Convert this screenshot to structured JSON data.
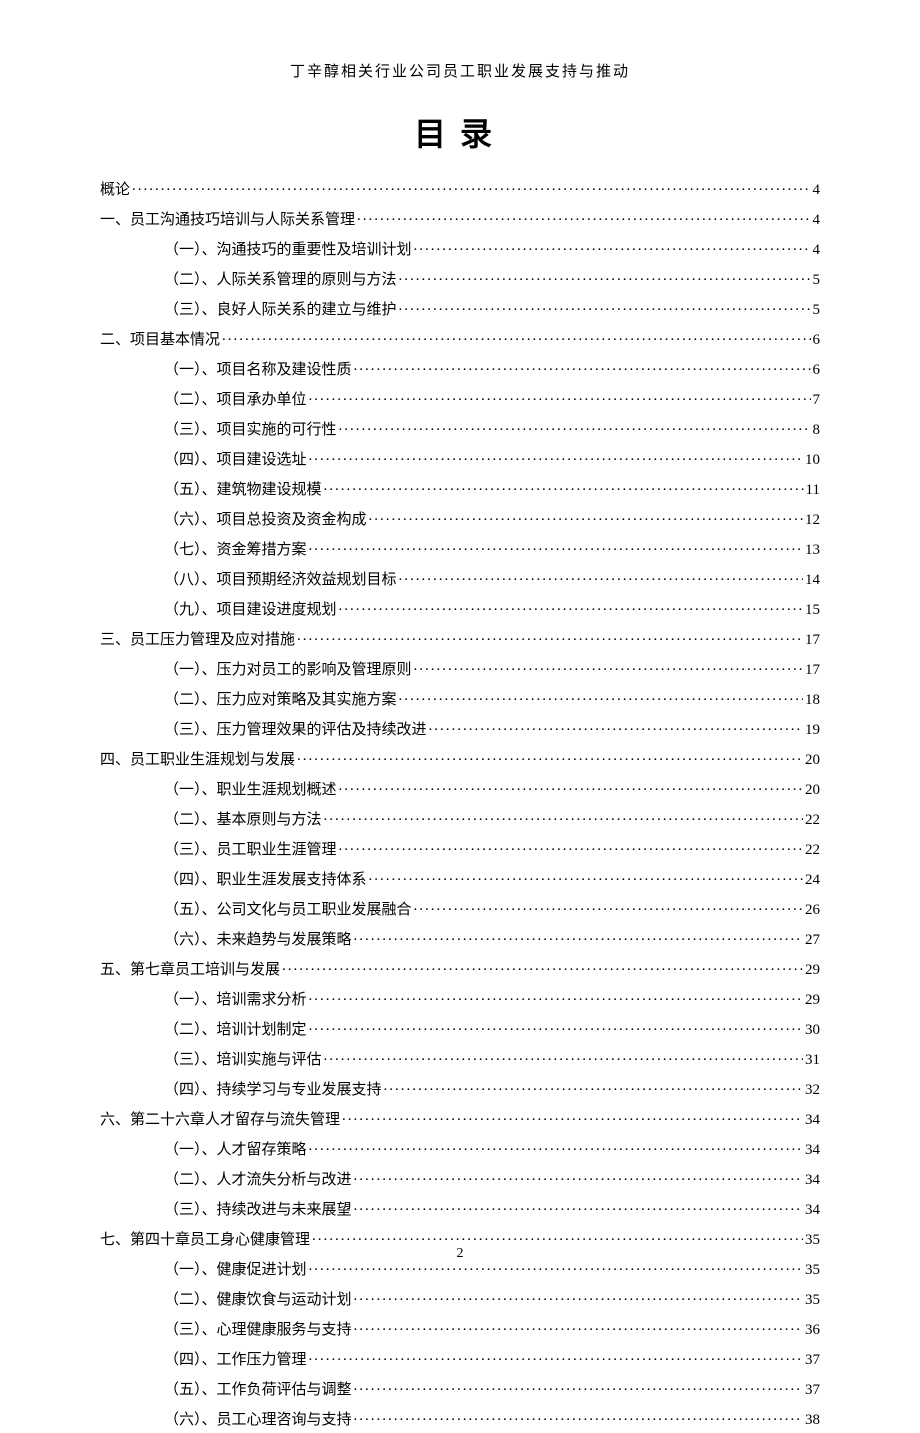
{
  "doc_header": "丁辛醇相关行业公司员工职业发展支持与推动",
  "toc_title": "目录",
  "page_number": "2",
  "toc": [
    {
      "level": 1,
      "label": "概论",
      "page": "4"
    },
    {
      "level": 1,
      "label": "一、员工沟通技巧培训与人际关系管理",
      "page": "4"
    },
    {
      "level": 2,
      "label": "（一）、沟通技巧的重要性及培训计划",
      "page": "4"
    },
    {
      "level": 2,
      "label": "（二）、人际关系管理的原则与方法",
      "page": "5"
    },
    {
      "level": 2,
      "label": "（三）、良好人际关系的建立与维护",
      "page": "5"
    },
    {
      "level": 1,
      "label": "二、项目基本情况",
      "page": "6"
    },
    {
      "level": 2,
      "label": "（一）、项目名称及建设性质",
      "page": "6"
    },
    {
      "level": 2,
      "label": "（二）、项目承办单位",
      "page": "7"
    },
    {
      "level": 2,
      "label": "（三）、项目实施的可行性",
      "page": "8"
    },
    {
      "level": 2,
      "label": "（四）、项目建设选址",
      "page": "10"
    },
    {
      "level": 2,
      "label": "（五）、建筑物建设规模",
      "page": "11"
    },
    {
      "level": 2,
      "label": "（六）、项目总投资及资金构成",
      "page": "12"
    },
    {
      "level": 2,
      "label": "（七）、资金筹措方案",
      "page": "13"
    },
    {
      "level": 2,
      "label": "（八）、项目预期经济效益规划目标",
      "page": "14"
    },
    {
      "level": 2,
      "label": "（九）、项目建设进度规划",
      "page": "15"
    },
    {
      "level": 1,
      "label": "三、员工压力管理及应对措施",
      "page": "17"
    },
    {
      "level": 2,
      "label": "（一）、压力对员工的影响及管理原则",
      "page": "17"
    },
    {
      "level": 2,
      "label": "（二）、压力应对策略及其实施方案",
      "page": "18"
    },
    {
      "level": 2,
      "label": "（三）、压力管理效果的评估及持续改进",
      "page": "19"
    },
    {
      "level": 1,
      "label": "四、员工职业生涯规划与发展",
      "page": "20"
    },
    {
      "level": 2,
      "label": "（一）、职业生涯规划概述",
      "page": "20"
    },
    {
      "level": 2,
      "label": "（二）、基本原则与方法",
      "page": "22"
    },
    {
      "level": 2,
      "label": "（三）、员工职业生涯管理",
      "page": "22"
    },
    {
      "level": 2,
      "label": "（四）、职业生涯发展支持体系",
      "page": "24"
    },
    {
      "level": 2,
      "label": "（五）、公司文化与员工职业发展融合",
      "page": "26"
    },
    {
      "level": 2,
      "label": "（六）、未来趋势与发展策略",
      "page": "27"
    },
    {
      "level": 1,
      "label": "五、第七章员工培训与发展",
      "page": "29"
    },
    {
      "level": 2,
      "label": "（一）、培训需求分析",
      "page": "29"
    },
    {
      "level": 2,
      "label": "（二）、培训计划制定",
      "page": "30"
    },
    {
      "level": 2,
      "label": "（三）、培训实施与评估",
      "page": "31"
    },
    {
      "level": 2,
      "label": "（四）、持续学习与专业发展支持",
      "page": "32"
    },
    {
      "level": 1,
      "label": "六、第二十六章人才留存与流失管理",
      "page": "34"
    },
    {
      "level": 2,
      "label": "（一）、人才留存策略",
      "page": "34"
    },
    {
      "level": 2,
      "label": "（二）、人才流失分析与改进",
      "page": "34"
    },
    {
      "level": 2,
      "label": "（三）、持续改进与未来展望",
      "page": "34"
    },
    {
      "level": 1,
      "label": "七、第四十章员工身心健康管理",
      "page": "35"
    },
    {
      "level": 2,
      "label": "（一）、健康促进计划",
      "page": "35"
    },
    {
      "level": 2,
      "label": "（二）、健康饮食与运动计划",
      "page": "35"
    },
    {
      "level": 2,
      "label": "（三）、心理健康服务与支持",
      "page": "36"
    },
    {
      "level": 2,
      "label": "（四）、工作压力管理",
      "page": "37"
    },
    {
      "level": 2,
      "label": "（五）、工作负荷评估与调整",
      "page": "37"
    },
    {
      "level": 2,
      "label": "（六）、员工心理咨询与支持",
      "page": "38"
    }
  ]
}
